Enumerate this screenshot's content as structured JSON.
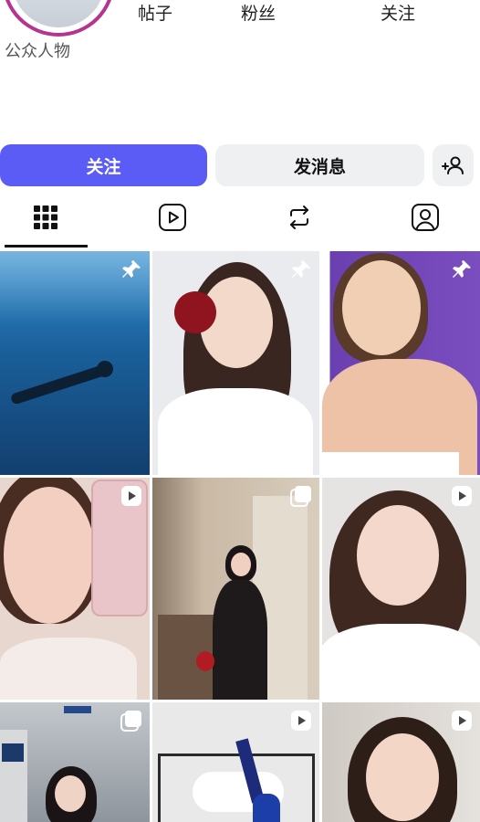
{
  "profile": {
    "category": "公众人物",
    "stats": {
      "posts_label": "帖子",
      "fans_label": "粉丝",
      "following_label": "关注"
    }
  },
  "actions": {
    "follow_label": "关注",
    "message_label": "发消息",
    "add_user_icon": "person-plus-icon"
  },
  "tabs": [
    {
      "icon": "grid-icon",
      "active": true
    },
    {
      "icon": "reels-icon",
      "active": false
    },
    {
      "icon": "repost-icon",
      "active": false
    },
    {
      "icon": "tagged-icon",
      "active": false
    }
  ],
  "grid": {
    "items": [
      {
        "kind": "photo",
        "badge": "pin-icon",
        "bg": "#1f6fa8"
      },
      {
        "kind": "photo",
        "badge": "pin-icon",
        "bg": "#e9ebee"
      },
      {
        "kind": "photo",
        "badge": "pin-icon",
        "bg": "#6a3fb0"
      },
      {
        "kind": "video",
        "badge": "reel-icon",
        "bg": "#e7d7cf"
      },
      {
        "kind": "carousel",
        "badge": "carousel-icon",
        "bg": "#c9b9a5"
      },
      {
        "kind": "video",
        "badge": "reel-icon",
        "bg": "#e6e4e2"
      },
      {
        "kind": "carousel",
        "badge": "carousel-icon",
        "bg": "#9aa0a7"
      },
      {
        "kind": "video",
        "badge": "reel-icon",
        "bg": "#e9e9ea"
      },
      {
        "kind": "video",
        "badge": "reel-icon",
        "bg": "#d8d4d0"
      }
    ]
  },
  "colors": {
    "accent": "#5b5bf5",
    "ring": "#b5348f",
    "button_bg": "#eff0f2"
  }
}
